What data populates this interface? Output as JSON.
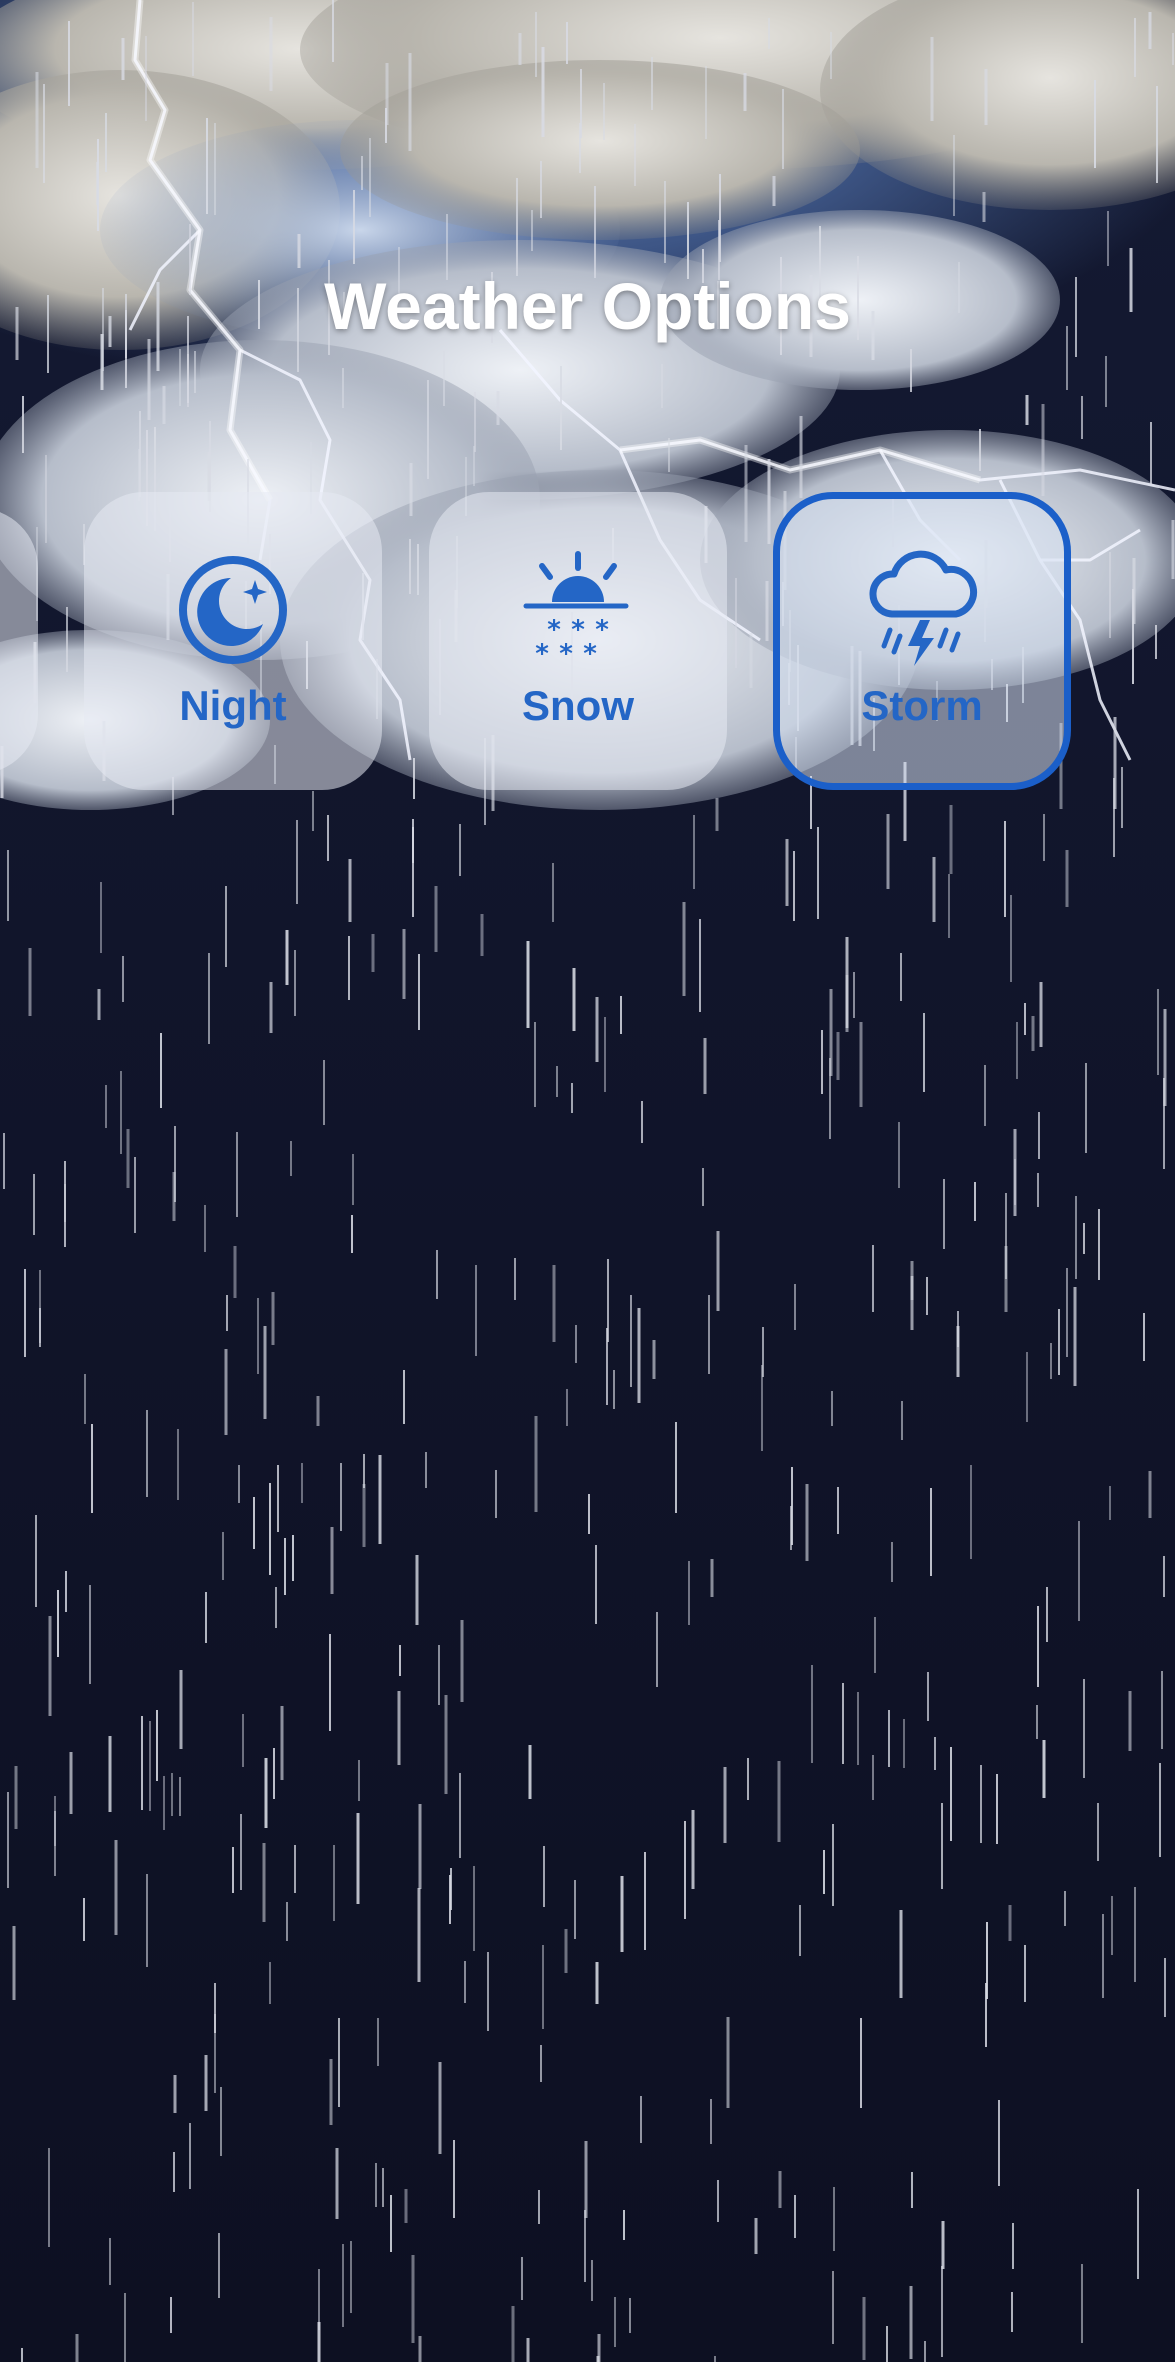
{
  "screen": {
    "title": "Weather Options"
  },
  "options": [
    {
      "label": "Night",
      "icon": "moon-stars-icon",
      "selected": false
    },
    {
      "label": "Snow",
      "icon": "sun-snow-icon",
      "selected": false
    },
    {
      "label": "Storm",
      "icon": "cloud-bolt-rain-icon",
      "selected": true
    }
  ],
  "colors": {
    "accent": "#1b5fc9",
    "label": "#2466c6",
    "background": "#11152b"
  }
}
